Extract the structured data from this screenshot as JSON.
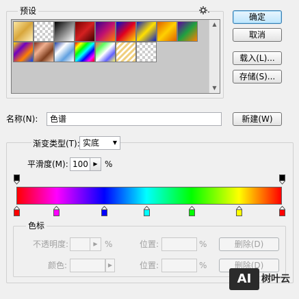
{
  "presets": {
    "legend": "预设",
    "gear_icon": "gear-icon",
    "swatches": [
      {
        "name": "gold",
        "bg": "linear-gradient(135deg,#fbe7a1,#d8a63b,#fff2c0)"
      },
      {
        "name": "transparent-fg",
        "bg": "checker"
      },
      {
        "name": "black-white",
        "bg": "linear-gradient(135deg,#000,#fff)"
      },
      {
        "name": "red-dark",
        "bg": "linear-gradient(135deg,#7a0000,#d42020,#3a0000)"
      },
      {
        "name": "violet-orange",
        "bg": "linear-gradient(135deg,#3a0090,#c01070,#ff8000)"
      },
      {
        "name": "blue-red-yellow",
        "bg": "linear-gradient(135deg,#0010d0,#e00020,#ffe000)"
      },
      {
        "name": "blue-yellow-blue",
        "bg": "linear-gradient(135deg,#1020c0,#ffe000,#1020c0)"
      },
      {
        "name": "orange-yellow-orange",
        "bg": "linear-gradient(135deg,#e06000,#ffd000,#e06000)"
      },
      {
        "name": "violet-green-orange",
        "bg": "linear-gradient(135deg,#6000a0,#20a040,#ff8000)"
      },
      {
        "name": "yellow-violet-orange-blue",
        "bg": "linear-gradient(135deg,#ffe000,#7000c0,#ff8000,#0040ff)"
      },
      {
        "name": "copper",
        "bg": "linear-gradient(135deg,#803020,#f0b090,#804020,#f8c8a8)"
      },
      {
        "name": "chrome",
        "bg": "linear-gradient(135deg,#2040a0,#ffffff,#60a0e0,#ffffff)"
      },
      {
        "name": "spectrum",
        "bg": "linear-gradient(135deg,#ff0000,#ffff00,#00ff00,#00ffff,#0000ff,#ff00ff,#ff0000)"
      },
      {
        "name": "transparent-rainbow",
        "bg": "linear-gradient(135deg,#ff6060,#60ff60,#ffffff,#6060ff,#ffff60)"
      },
      {
        "name": "transparent-stripes",
        "bg": "repeating-linear-gradient(135deg,#f0d080 0 3px,#fff 3px 6px)"
      },
      {
        "name": "neutral-density",
        "bg": "checker"
      }
    ]
  },
  "buttons": {
    "ok": "确定",
    "cancel": "取消",
    "load": "载入(L)...",
    "save": "存储(S)...",
    "new": "新建(W)"
  },
  "name_row": {
    "label": "名称(N):",
    "value": "色谱"
  },
  "gradient_type": {
    "label": "渐变类型(T):",
    "value": "实底"
  },
  "smoothness": {
    "label": "平滑度(M):",
    "value": "100",
    "unit": "%"
  },
  "gradient_bar": {
    "opacity_stops": [
      {
        "location_pct": 0,
        "color": "#000000"
      },
      {
        "location_pct": 100,
        "color": "#000000"
      }
    ],
    "color_stops": [
      {
        "location_pct": 0,
        "color": "#ff0000"
      },
      {
        "location_pct": 15,
        "color": "#ff00ff"
      },
      {
        "location_pct": 33,
        "color": "#0000ff"
      },
      {
        "location_pct": 49,
        "color": "#00ffff"
      },
      {
        "location_pct": 66,
        "color": "#00ff00"
      },
      {
        "location_pct": 84,
        "color": "#ffff00"
      },
      {
        "location_pct": 100,
        "color": "#ff0000"
      }
    ]
  },
  "color_stops_group": {
    "legend": "色标",
    "opacity_label": "不透明度:",
    "opacity_unit": "%",
    "color_label": "颜色:",
    "location_label_1": "位置:",
    "location_unit_1": "%",
    "location_label_2": "位置:",
    "location_unit_2": "%",
    "delete_1": "删除(D)",
    "delete_2": "删除(D)"
  },
  "watermark": {
    "logo_text": "AI",
    "brand_text": "树叶云"
  }
}
